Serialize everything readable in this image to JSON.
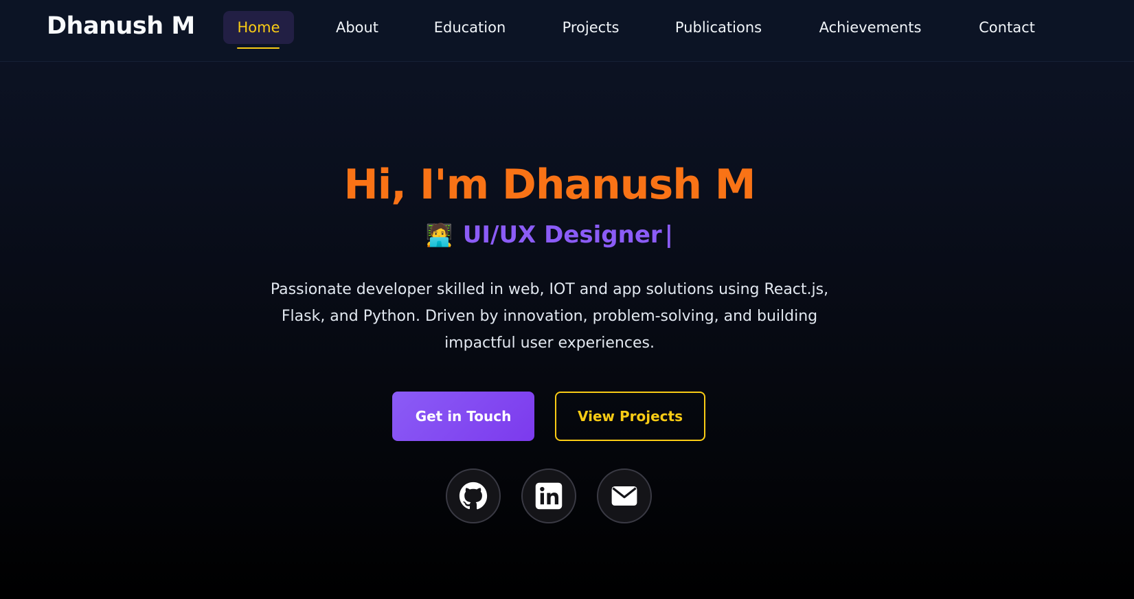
{
  "brand": "Dhanush M",
  "nav": {
    "items": [
      {
        "label": "Home",
        "active": true
      },
      {
        "label": "About"
      },
      {
        "label": "Education"
      },
      {
        "label": "Projects"
      },
      {
        "label": "Publications"
      },
      {
        "label": "Achievements"
      },
      {
        "label": "Contact"
      }
    ]
  },
  "hero": {
    "title": "Hi, I'm Dhanush M",
    "role_emoji": "🧑‍💻",
    "role": "UI/UX Designer",
    "caret": "|",
    "description": "Passionate developer skilled in web, IOT and app solutions using React.js, Flask, and Python. Driven by innovation, problem-solving, and building impactful user experiences.",
    "primary_button": "Get in Touch",
    "secondary_button": "View Projects"
  },
  "social": [
    {
      "icon": "github-icon"
    },
    {
      "icon": "linkedin-icon"
    },
    {
      "icon": "mail-icon"
    }
  ],
  "colors": {
    "accent_orange": "#f97316",
    "accent_purple": "#8b5cf6",
    "accent_yellow": "#facc15",
    "nav_bg": "#0c1425"
  }
}
